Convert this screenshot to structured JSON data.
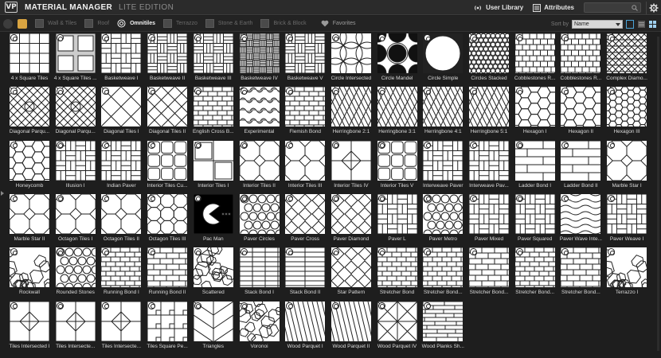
{
  "app": {
    "title": "MATERIAL MANAGER",
    "edition": "LITE EDITION",
    "user_library": "User Library",
    "attributes": "Attributes"
  },
  "toolbar": {
    "categories": [
      {
        "label": "Wall & Tiles",
        "active": false
      },
      {
        "label": "Roof",
        "active": false
      },
      {
        "label": "Omnitiles",
        "active": true
      },
      {
        "label": "Terrazzo",
        "active": false
      },
      {
        "label": "Stone & Earth",
        "active": false
      },
      {
        "label": "Brick & Block",
        "active": false
      }
    ],
    "favorites": "Favorites",
    "sort_label": "Sort by",
    "sort_value": "Name",
    "accent": "#d9a441"
  },
  "tiles": [
    {
      "label": "4 x Square Tiles",
      "pattern": "grid4"
    },
    {
      "label": "4 x Square Tiles ...",
      "pattern": "square-inset"
    },
    {
      "label": "Basketweave I",
      "pattern": "basket"
    },
    {
      "label": "Basketweave II",
      "pattern": "basket2"
    },
    {
      "label": "Basketweave III",
      "pattern": "basket3"
    },
    {
      "label": "Basketweave IV",
      "pattern": "basket4"
    },
    {
      "label": "Basketweave V",
      "pattern": "basket5"
    },
    {
      "label": "Circle Intersected",
      "pattern": "circles-int"
    },
    {
      "label": "Circle Mandel",
      "pattern": "circle-mandel"
    },
    {
      "label": "Circle Simple",
      "pattern": "circle-simple"
    },
    {
      "label": "Circles Stacked",
      "pattern": "circles-small"
    },
    {
      "label": "Cobblestones R...",
      "pattern": "cobble"
    },
    {
      "label": "Cobblestones R...",
      "pattern": "cobble2"
    },
    {
      "label": "Complex Diamo...",
      "pattern": "complex"
    },
    {
      "label": "Diagonal Parqu...",
      "pattern": "diag-parquet"
    },
    {
      "label": "Diagonal Parqu...",
      "pattern": "diag-parquet2"
    },
    {
      "label": "Diagonal Tiles I",
      "pattern": "diag-tiles"
    },
    {
      "label": "Diagonal Tiles II",
      "pattern": "diag-tiles2"
    },
    {
      "label": "English Cross B...",
      "pattern": "bricks"
    },
    {
      "label": "Experimental",
      "pattern": "experimental"
    },
    {
      "label": "Flemish Bond",
      "pattern": "bricks"
    },
    {
      "label": "Herringbone 2:1",
      "pattern": "herring"
    },
    {
      "label": "Herringbone 3:1",
      "pattern": "herring2"
    },
    {
      "label": "Herringbone 4:1",
      "pattern": "herring3"
    },
    {
      "label": "Herringbone 5:1",
      "pattern": "herring4"
    },
    {
      "label": "Hexagon I",
      "pattern": "hex"
    },
    {
      "label": "Hexagon II",
      "pattern": "hex2"
    },
    {
      "label": "Hexagon III",
      "pattern": "hex3"
    },
    {
      "label": "Honeycomb",
      "pattern": "honeycomb"
    },
    {
      "label": "Illusion I",
      "pattern": "illusion"
    },
    {
      "label": "Indian Paver",
      "pattern": "indian"
    },
    {
      "label": "Interior Tiles Cu...",
      "pattern": "interior-cu"
    },
    {
      "label": "Interior Tiles I",
      "pattern": "interior1"
    },
    {
      "label": "Interior Tiles II",
      "pattern": "interior2"
    },
    {
      "label": "Interior Tiles III",
      "pattern": "octagon"
    },
    {
      "label": "Interior Tiles IV",
      "pattern": "interior4"
    },
    {
      "label": "Interior Tiles V",
      "pattern": "interior5"
    },
    {
      "label": "Interweave Paver",
      "pattern": "interweave"
    },
    {
      "label": "Interweave Pav...",
      "pattern": "interweave2"
    },
    {
      "label": "Ladder Bond I",
      "pattern": "ladder"
    },
    {
      "label": "Ladder Bond II",
      "pattern": "ladder2"
    },
    {
      "label": "Marble Star I",
      "pattern": "marble-star"
    },
    {
      "label": "Marble Star II",
      "pattern": "marble-star2"
    },
    {
      "label": "Octagon Tiles I",
      "pattern": "octagon"
    },
    {
      "label": "Octagon Tiles II",
      "pattern": "octagon2"
    },
    {
      "label": "Octagon Tiles III",
      "pattern": "octagon3"
    },
    {
      "label": "Pac Man",
      "pattern": "pacman"
    },
    {
      "label": "Paver Circles",
      "pattern": "paver-circles"
    },
    {
      "label": "Paver Cross",
      "pattern": "paver-cross"
    },
    {
      "label": "Paver Diamond",
      "pattern": "paver-diamond"
    },
    {
      "label": "Paver L",
      "pattern": "paver-l"
    },
    {
      "label": "Paver Metro",
      "pattern": "paver-metro"
    },
    {
      "label": "Paver Mixed",
      "pattern": "paver-mixed"
    },
    {
      "label": "Paver Squared",
      "pattern": "paver-squared"
    },
    {
      "label": "Paver Wave Inte...",
      "pattern": "paver-wave"
    },
    {
      "label": "Paver Weave I",
      "pattern": "paver-weave"
    },
    {
      "label": "Rockwall",
      "pattern": "rockwall"
    },
    {
      "label": "Rounded Stones",
      "pattern": "rounded"
    },
    {
      "label": "Running Bond I",
      "pattern": "running"
    },
    {
      "label": "Running Bond II",
      "pattern": "running2"
    },
    {
      "label": "Scattered",
      "pattern": "scattered"
    },
    {
      "label": "Stack Bond I",
      "pattern": "stack"
    },
    {
      "label": "Stack Bond II",
      "pattern": "stack2"
    },
    {
      "label": "Star Pattern",
      "pattern": "star"
    },
    {
      "label": "Stretcher Bond",
      "pattern": "stretcher"
    },
    {
      "label": "Stretcher Bond...",
      "pattern": "stretcher"
    },
    {
      "label": "Stretcher Bond...",
      "pattern": "stretcher2"
    },
    {
      "label": "Stretcher Bond...",
      "pattern": "stretcher"
    },
    {
      "label": "Stretcher Bond...",
      "pattern": "stretcher2"
    },
    {
      "label": "Terrazzo I",
      "pattern": "terrazzo"
    },
    {
      "label": "Tiles Intersected I",
      "pattern": "tiles-int"
    },
    {
      "label": "Tiles Intersecte...",
      "pattern": "tiles-int2"
    },
    {
      "label": "Tiles Intersecte...",
      "pattern": "tiles-int3"
    },
    {
      "label": "Tiles Square Pe...",
      "pattern": "tiles-sq-pe"
    },
    {
      "label": "Triangles",
      "pattern": "triangles"
    },
    {
      "label": "Voronoi",
      "pattern": "voronoi"
    },
    {
      "label": "Wood Parquet I",
      "pattern": "wood1"
    },
    {
      "label": "Wood Parquet II",
      "pattern": "wood2"
    },
    {
      "label": "Wood Parquet IV",
      "pattern": "wood4"
    },
    {
      "label": "Wood Planks Sh...",
      "pattern": "planks"
    }
  ]
}
